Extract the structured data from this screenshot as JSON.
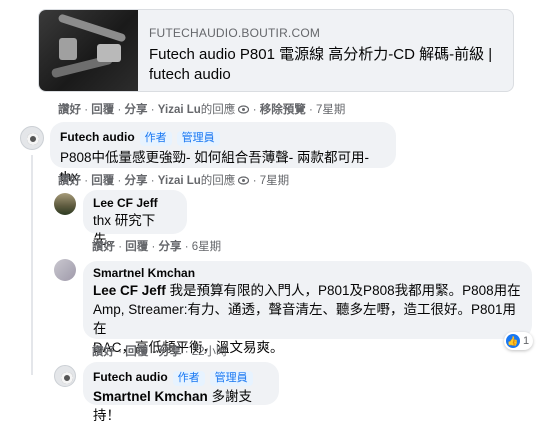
{
  "link_preview": {
    "domain": "FUTECHAUDIO.BOUTIR.COM",
    "title": "Futech audio P801 電源線 高分析力-CD 解碼-前級 | futech audio"
  },
  "post_actions": {
    "like": "讚好",
    "reply": "回覆",
    "share": "分享",
    "sep": "·",
    "hidden_note_prefix": "Yizai Lu",
    "hidden_note_suffix": "的回應",
    "remove_preview": "移除預覽",
    "time": "7星期"
  },
  "comments": [
    {
      "author": "Futech audio",
      "badges": [
        "作者",
        "管理員"
      ],
      "text": "P808中低量感更強勁- 如何組合吾薄聲- 兩款都可用-thx",
      "actions": {
        "like": "讚好",
        "reply": "回覆",
        "share": "分享",
        "note_name": "Yizai Lu",
        "note_suffix": "的回應",
        "time": "7星期"
      }
    },
    {
      "author": "Lee CF Jeff",
      "text": "thx 研究下先。",
      "actions": {
        "like": "讚好",
        "reply": "回覆",
        "share": "分享",
        "time": "6星期"
      }
    },
    {
      "author": "Smartnel Kmchan",
      "mention": "Lee CF Jeff",
      "text_rest": " 我是預算有限的入門人，P801及P808我都用緊。P808用在",
      "text_line2": "Amp, Streamer:有力、通透，聲音清左、聽多左嘢，造工很好。P801用在",
      "text_line3": "DAC，高低頻平衡，溫文易爽。",
      "actions": {
        "like": "讚好",
        "reply": "回覆",
        "share": "分享",
        "time": "22小時"
      },
      "reaction_count": "1"
    },
    {
      "author": "Futech audio",
      "badges": [
        "作者",
        "管理員"
      ],
      "mention": "Smartnel Kmchan",
      "text_rest": " 多謝支持！"
    }
  ],
  "icons": {
    "hidden": "eye-icon",
    "like_reaction": "thumbs-up-icon"
  },
  "colors": {
    "accent": "#1877f2",
    "bubble": "#f0f2f5",
    "meta_text": "#65676b"
  }
}
